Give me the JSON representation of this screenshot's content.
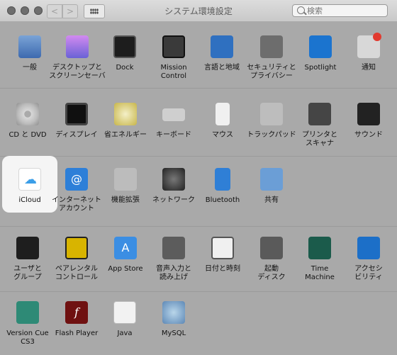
{
  "window": {
    "title": "システム環境設定",
    "search_placeholder": "検索",
    "nav_back": "<",
    "nav_forward": ">"
  },
  "rows": [
    [
      {
        "label": "一般",
        "icon": "general-icon"
      },
      {
        "label": "デスクトップと\nスクリーンセーバ",
        "icon": "desktop-icon"
      },
      {
        "label": "Dock",
        "icon": "dock-icon"
      },
      {
        "label": "Mission\nControl",
        "icon": "mission-control-icon"
      },
      {
        "label": "言語と地域",
        "icon": "language-icon"
      },
      {
        "label": "セキュリティと\nプライバシー",
        "icon": "security-icon"
      },
      {
        "label": "Spotlight",
        "icon": "spotlight-icon"
      },
      {
        "label": "通知",
        "icon": "notifications-icon"
      }
    ],
    [
      {
        "label": "CD と DVD",
        "icon": "cd-dvd-icon"
      },
      {
        "label": "ディスプレイ",
        "icon": "display-icon"
      },
      {
        "label": "省エネルギー",
        "icon": "energy-saver-icon"
      },
      {
        "label": "キーボード",
        "icon": "keyboard-icon"
      },
      {
        "label": "マウス",
        "icon": "mouse-icon"
      },
      {
        "label": "トラックパッド",
        "icon": "trackpad-icon"
      },
      {
        "label": "プリンタと\nスキャナ",
        "icon": "printer-icon"
      },
      {
        "label": "サウンド",
        "icon": "sound-icon"
      }
    ],
    [
      {
        "label": "iCloud",
        "icon": "icloud-icon"
      },
      {
        "label": "インターネット\nアカウント",
        "icon": "internet-accounts-icon"
      },
      {
        "label": "機能拡張",
        "icon": "extensions-icon"
      },
      {
        "label": "ネットワーク",
        "icon": "network-icon"
      },
      {
        "label": "Bluetooth",
        "icon": "bluetooth-icon"
      },
      {
        "label": "共有",
        "icon": "sharing-icon"
      }
    ],
    [
      {
        "label": "ユーザと\nグループ",
        "icon": "users-icon"
      },
      {
        "label": "ペアレンタル\nコントロール",
        "icon": "parental-controls-icon"
      },
      {
        "label": "App Store",
        "icon": "app-store-icon"
      },
      {
        "label": "音声入力と\n読み上げ",
        "icon": "dictation-icon"
      },
      {
        "label": "日付と時刻",
        "icon": "date-time-icon"
      },
      {
        "label": "起動\nディスク",
        "icon": "startup-disk-icon"
      },
      {
        "label": "Time\nMachine",
        "icon": "time-machine-icon"
      },
      {
        "label": "アクセシ\nビリティ",
        "icon": "accessibility-icon"
      }
    ],
    [
      {
        "label": "Version Cue\nCS3",
        "icon": "version-cue-icon"
      },
      {
        "label": "Flash Player",
        "icon": "flash-player-icon"
      },
      {
        "label": "Java",
        "icon": "java-icon"
      },
      {
        "label": "MySQL",
        "icon": "mysql-icon"
      }
    ]
  ]
}
